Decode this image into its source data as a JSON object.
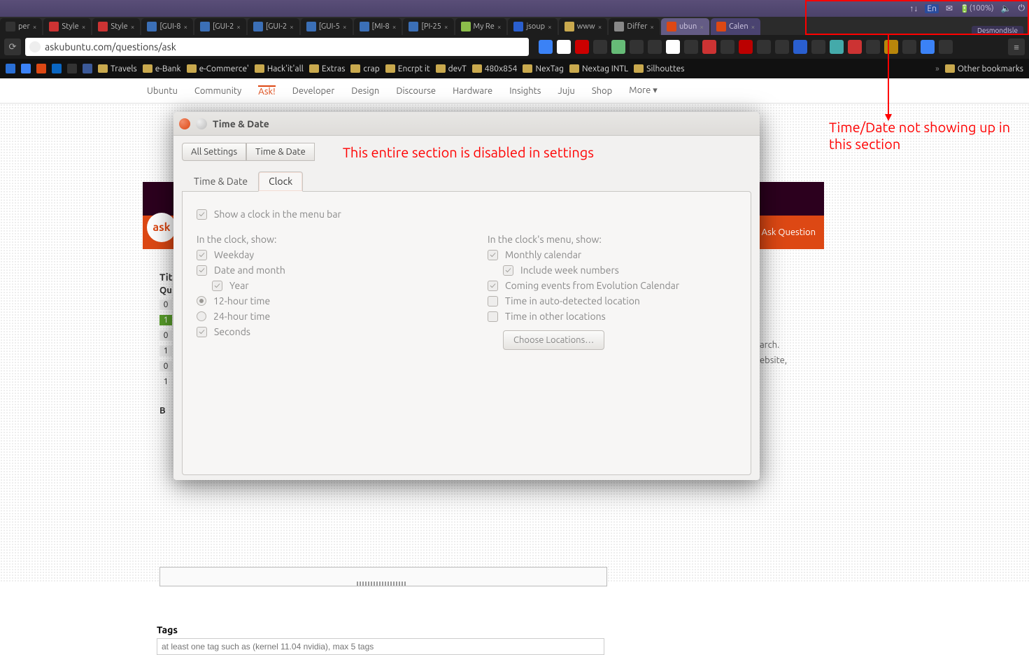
{
  "system_panel": {
    "network_icon": "↑↓",
    "lang": "En",
    "mail_icon": "✉",
    "battery": "(100%)",
    "volume": "🔇",
    "gear": "⚙",
    "user": "DesmondIsle"
  },
  "browser": {
    "tabs": [
      {
        "label": "per",
        "fav": "#333"
      },
      {
        "label": "Style",
        "fav": "#cc3333"
      },
      {
        "label": "Style",
        "fav": "#cc3333"
      },
      {
        "label": "[GUI-8",
        "fav": "#3b6fb6"
      },
      {
        "label": "[GUI-2",
        "fav": "#3b6fb6"
      },
      {
        "label": "[GUI-2",
        "fav": "#3b6fb6"
      },
      {
        "label": "[GUI-5",
        "fav": "#3b6fb6"
      },
      {
        "label": "[MI-8",
        "fav": "#3b6fb6"
      },
      {
        "label": "[PI-25",
        "fav": "#3b6fb6"
      },
      {
        "label": "My Re",
        "fav": "#8bbd4a"
      },
      {
        "label": "jsoup",
        "fav": "#2a5fcf"
      },
      {
        "label": "www",
        "fav": "#c9a94e"
      },
      {
        "label": "Differ",
        "fav": "#888"
      },
      {
        "label": "ubun",
        "fav": "#dd4814",
        "cls": "ubun"
      },
      {
        "label": "Calen",
        "fav": "#dd4814",
        "cls": "calen"
      }
    ],
    "user_chip": "DesmondIsle",
    "url": "askubuntu.com/questions/ask",
    "ext_colors": [
      "#3b82f6",
      "#fff",
      "#c00",
      "#333",
      "#6b7",
      "#333",
      "#333",
      "#fff",
      "#333",
      "#c33",
      "#333",
      "#b00",
      "#333",
      "#333",
      "#2a5fcf",
      "#333",
      "#4aa",
      "#c33",
      "#333",
      "#b8860b",
      "#333",
      "#3b82f6",
      "#333"
    ]
  },
  "bookmarks": {
    "items": [
      {
        "t": "",
        "ico": "#2a6fd6"
      },
      {
        "t": "",
        "ico": "#3b82f6"
      },
      {
        "t": "",
        "ico": "#dd4814"
      },
      {
        "t": "",
        "ico": "#0a66c2"
      },
      {
        "t": "",
        "ico": "#333"
      },
      {
        "t": "",
        "ico": "#3b5998"
      }
    ],
    "folders": [
      "Travels",
      "e-Bank",
      "e-Commerce'",
      "Hack'it'all",
      "Extras",
      "crap",
      "Encrpt it",
      "devT",
      "480x854",
      "NexTag",
      "Nextag INTL",
      "Silhouttes"
    ],
    "other": "Other bookmarks"
  },
  "au_nav": [
    "Ubuntu",
    "Community",
    "Ask!",
    "Developer",
    "Design",
    "Discourse",
    "Hardware",
    "Insights",
    "Juju",
    "Shop",
    "More ▾"
  ],
  "au": {
    "ask_question": "Ask Question",
    "logo": "ask",
    "tit": "Tit",
    "qu": "Qu",
    "nums": [
      "0",
      "1",
      "0",
      "1",
      "0",
      "1"
    ],
    "b": "B",
    "peek1": "arch.",
    "peek2": "ebsite,",
    "tags_label": "Tags",
    "tags_placeholder": "at least one tag such as (kernel 11.04 nvidia), max 5 tags"
  },
  "annotations": {
    "main": "This entire section is disabled in settings",
    "side": "Time/Date not showing up in this section"
  },
  "dialog": {
    "title": "Time & Date",
    "crumb_all": "All Settings",
    "crumb_here": "Time & Date",
    "tab1": "Time & Date",
    "tab2": "Clock",
    "show_clock": "Show a clock in the menu bar",
    "left_head": "In the clock, show:",
    "weekday": "Weekday",
    "datemonth": "Date and month",
    "year": "Year",
    "t12": "12-hour time",
    "t24": "24-hour time",
    "seconds": "Seconds",
    "right_head": "In the clock's menu, show:",
    "monthly": "Monthly calendar",
    "weeknum": "Include week numbers",
    "evo": "Coming events from Evolution Calendar",
    "auto_loc": "Time in auto-detected location",
    "other_loc": "Time in other locations",
    "choose": "Choose Locations…"
  }
}
